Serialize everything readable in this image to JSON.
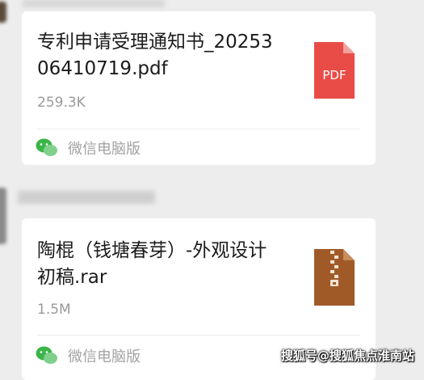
{
  "messages": [
    {
      "file_name": "专利申请受理通知书_2025306410719.pdf",
      "file_size": "259.3K",
      "file_type": "PDF",
      "file_icon": "pdf-file-icon",
      "source": "微信电脑版",
      "source_icon": "wechat-icon"
    },
    {
      "file_name": "陶棍（钱塘春芽）-外观设计初稿.rar",
      "file_size": "1.5M",
      "file_type": "rar",
      "file_icon": "zip-archive-icon",
      "source": "微信电脑版",
      "source_icon": "wechat-icon"
    }
  ],
  "watermark": "搜狐号@搜狐焦点淮南站",
  "colors": {
    "background": "#ededed",
    "bubble": "#ffffff",
    "pdf_red": "#e94c47",
    "archive_brown": "#a05a28",
    "wechat_green": "#3bb54a"
  }
}
